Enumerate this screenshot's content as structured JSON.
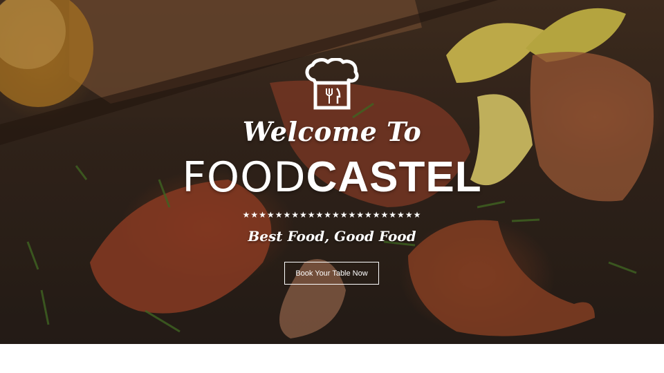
{
  "hero": {
    "welcome": "Welcome To",
    "brand_light": "FOOD",
    "brand_bold": "CASTEL",
    "divider": "★★★★★★★★★★★★★★★★★★★★★★",
    "tagline": "Best Food, Good Food",
    "cta_label": "Book Your Table Now"
  },
  "icons": {
    "logo": "chef-hat-with-fork-knife-icon"
  },
  "colors": {
    "text": "#ffffff",
    "page_background": "#ffffff",
    "hero_tint": "#3a2a1f"
  }
}
